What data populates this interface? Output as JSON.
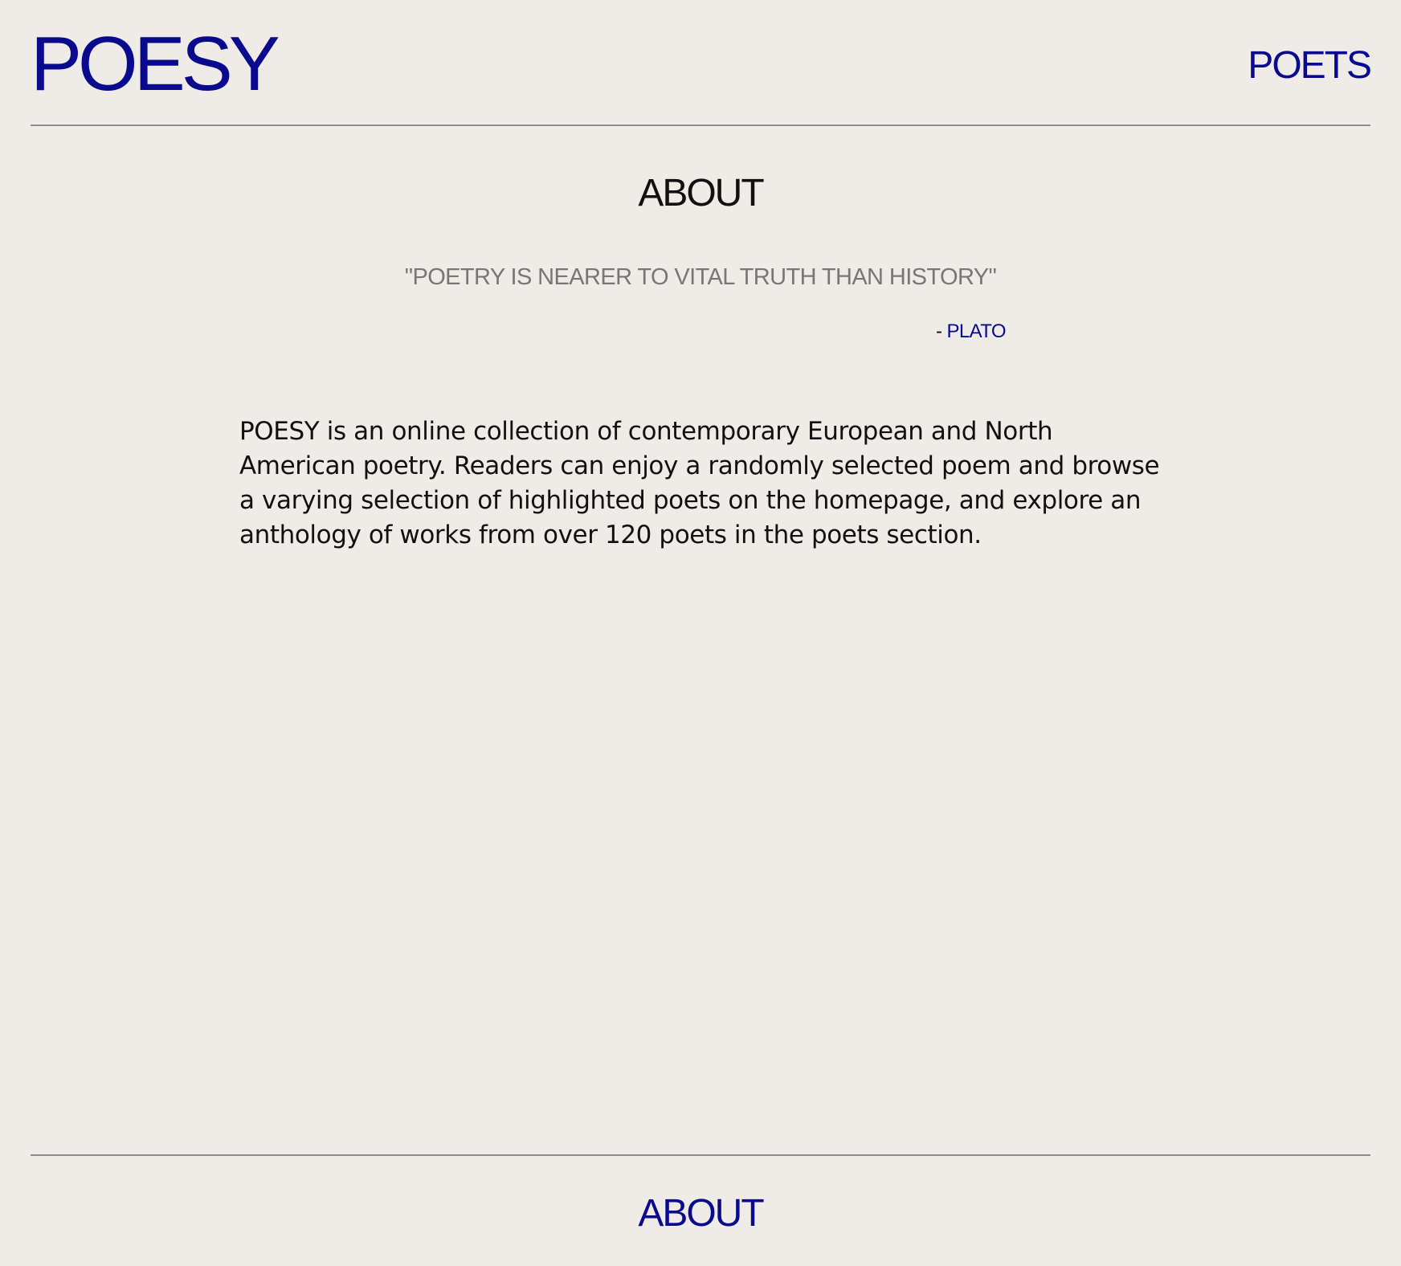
{
  "header": {
    "logo": "POESY",
    "nav_poets": "POETS"
  },
  "main": {
    "title": "ABOUT",
    "quote": "\"POETRY IS NEARER TO VITAL TRUTH THAN HISTORY\"",
    "attribution_dash": "- ",
    "attribution_name": "PLATO",
    "description": "POESY is an online collection of contemporary European and North American poetry. Readers can enjoy a randomly selected poem and browse a varying selection of highlighted poets on the homepage, and explore an anthology of works from over 120 poets in the poets section."
  },
  "footer": {
    "about_link": "ABOUT"
  },
  "colors": {
    "background": "#efebe6",
    "accent": "#0a0a8f",
    "text": "#111111",
    "quote": "#777777",
    "rule": "#8c8c8c"
  }
}
